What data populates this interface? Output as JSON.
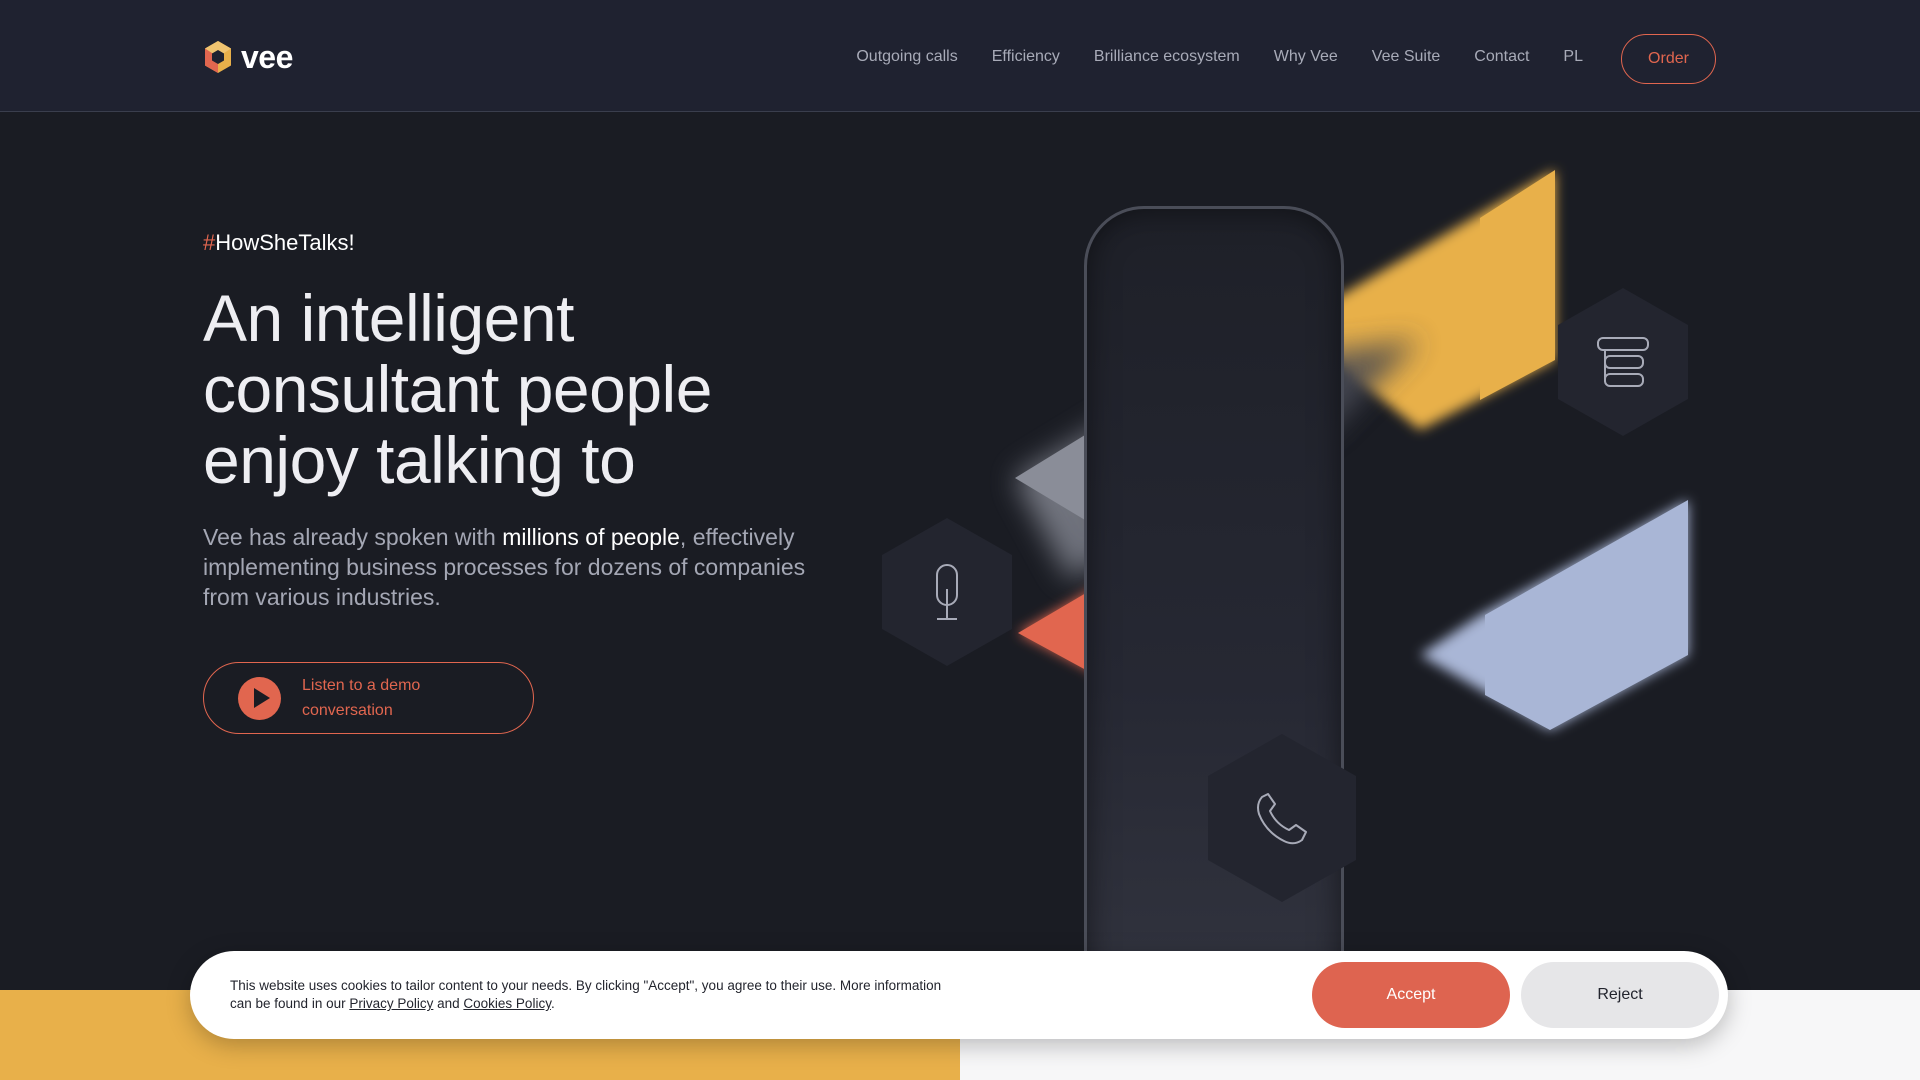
{
  "header": {
    "logo_text": "vee",
    "nav": [
      "Outgoing calls",
      "Efficiency",
      "Brilliance ecosystem",
      "Why Vee",
      "Vee Suite",
      "Contact",
      "PL"
    ],
    "order_label": "Order"
  },
  "hero": {
    "tagline_hash": "#",
    "tagline_text": "HowSheTalks!",
    "title": "An intelligent consultant people enjoy talking to",
    "subtitle_pre": "Vee has already spoken with ",
    "subtitle_highlight": "millions of people",
    "subtitle_post": ", effectively implementing business processes for dozens of companies from various industries.",
    "demo_label": "Listen to a demo conversation"
  },
  "illustration": {
    "icons": [
      "microphone-icon",
      "phone-icon",
      "database-stack-icon"
    ],
    "colors": {
      "orange": "#e1664f",
      "yellow": "#e8b04a",
      "lavender": "#a9b6d6",
      "grey": "#7a7d88"
    }
  },
  "cookie": {
    "text_pre": "This website uses cookies to tailor content to your needs. By clicking \"Accept\", you agree to their use. More information can be found in our ",
    "privacy_link": "Privacy Policy",
    "and_text": " and ",
    "cookies_link": "Cookies Policy",
    "text_end": ".",
    "accept_label": "Accept",
    "reject_label": "Reject"
  },
  "colors": {
    "accent": "#e1664f",
    "background": "#1a1c23",
    "header": "#1f2230"
  }
}
